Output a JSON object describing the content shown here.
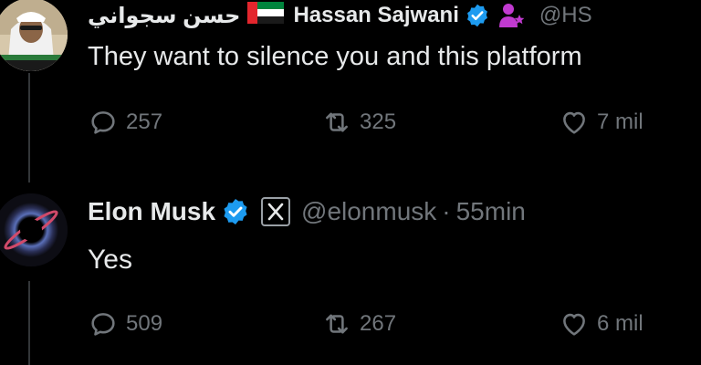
{
  "tweet1": {
    "name_arabic": "حسن سجواني",
    "name": "Hassan Sajwani",
    "handle": "@HS",
    "text": "They want to silence you and this platform",
    "replies": "257",
    "reposts": "325",
    "likes": "7 mil"
  },
  "tweet2": {
    "name": "Elon Musk",
    "handle": "@elonmusk",
    "separator": "·",
    "time": "55min",
    "text": "Yes",
    "replies": "509",
    "reposts": "267",
    "likes": "6 mil"
  },
  "colors": {
    "background": "#000000",
    "text": "#e7e9ea",
    "muted": "#71767b",
    "verified": "#1d9bf0",
    "affiliate": "#c13ad0"
  },
  "icons": {
    "flag": "uae-flag-icon",
    "verified": "verified-badge-icon",
    "affiliate": "affiliate-person-icon",
    "x_logo": "x-logo-icon",
    "reply": "reply-icon",
    "repost": "repost-icon",
    "like": "like-icon"
  }
}
